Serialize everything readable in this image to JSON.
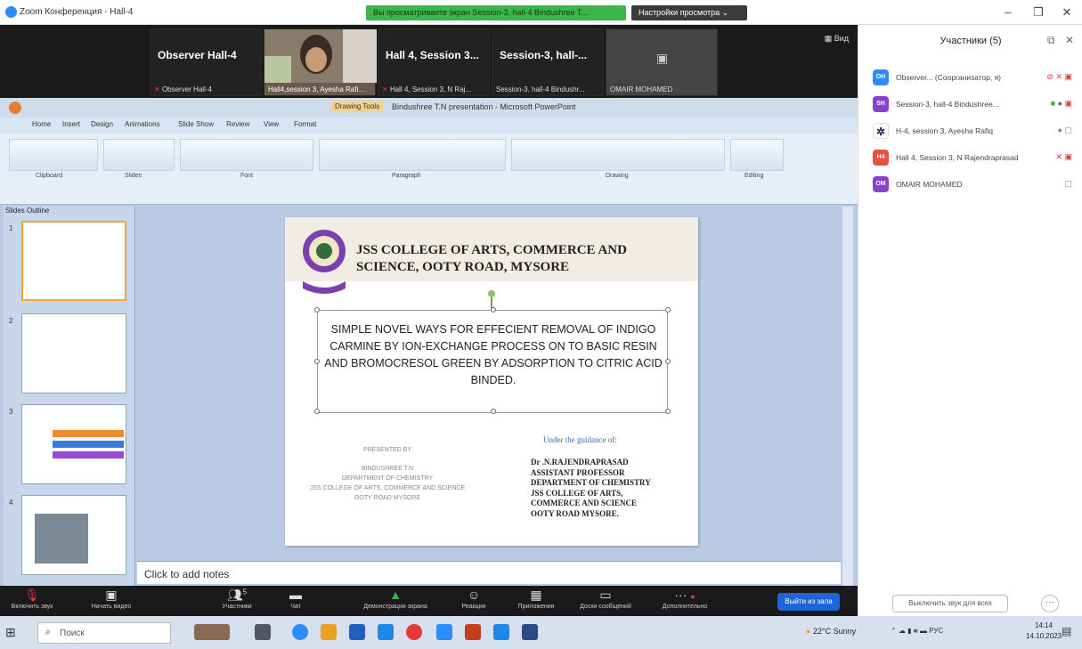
{
  "window": {
    "app_title": "Zoom Конференция - Hall-4",
    "share_banner": "Вы просматриваете экран Session-3, hall-4 Bindushree T...",
    "share_settings": "Настройки просмотра",
    "minimize": "–",
    "maximize": "❐",
    "close": "✕"
  },
  "gallery": {
    "view_label": "Вид",
    "tiles": [
      {
        "name": "Observer Hall-4",
        "footer": "Observer Hall-4"
      },
      {
        "name": "",
        "footer": "Hall4,session 3, Ayesha Rafi..."
      },
      {
        "name": "Hall 4, Session 3...",
        "footer": "Hall 4, Session 3, N Raj..."
      },
      {
        "name": "Session-3, hall-...",
        "footer": "Session-3, hall-4 Bindushr..."
      },
      {
        "name": "",
        "footer": "OMAIR MOHAMED"
      }
    ]
  },
  "panel": {
    "title": "Участники (5)",
    "participants": [
      {
        "initials": "OH",
        "color": "#2d8cff",
        "name": "Observer... (Соорганизатор, я)"
      },
      {
        "initials": "SH",
        "color": "#8b3fd1",
        "name": "Session-3, hall-4 Bindushree..."
      },
      {
        "initials": "",
        "color": "#ffffff",
        "name": "H-4, session 3, Ayesha Rafiq"
      },
      {
        "initials": "H4",
        "color": "#e5533d",
        "name": "Hall 4, Session 3, N Rajendraprasad"
      },
      {
        "initials": "OM",
        "color": "#8b3fd1",
        "name": "OMAIR MOHAMED"
      }
    ],
    "unmute_all": "Выключить звук для всех",
    "more": "···"
  },
  "ppt": {
    "drawing_tools": "Drawing Tools",
    "title": "Bindushree T.N presentation - Microsoft PowerPoint",
    "tabs": [
      "Home",
      "Insert",
      "Design",
      "Animations",
      "Slide Show",
      "Review",
      "View",
      "Format"
    ],
    "groups": [
      "Clipboard",
      "Slides",
      "Font",
      "Paragraph",
      "Drawing",
      "Editing"
    ],
    "thumb_tabs": "Slides   Outline",
    "thumb_numbers": [
      "1",
      "2",
      "3",
      "4"
    ],
    "notes": "Click to add notes"
  },
  "slide": {
    "college": "JSS COLLEGE OF ARTS, COMMERCE AND SCIENCE, OOTY ROAD, MYSORE",
    "title": "SIMPLE NOVEL WAYS FOR EFFECIENT REMOVAL OF INDIGO CARMINE BY ION-EXCHANGE PROCESS ON TO BASIC RESIN AND BROMOCRESOL GREEN BY ADSORPTION TO CITRIC ACID BINDED.",
    "presented_by": "PRESENTED BY",
    "presenter": "BINDUSHREE T.N",
    "presenter_dept": "DEPARTMENT OF CHEMISTRY",
    "presenter_college": "JSS COLLEGE OF ARTS, COMMERCE AND SCIENCE",
    "presenter_addr": "OOTY ROAD MYSORE",
    "guidance": "Under the guidance of:",
    "guide_lines": [
      "Dr .N.RAJENDRAPRASAD",
      "ASSISTANT PROFESSOR",
      "DEPARTMENT OF CHEMISTRY",
      "JSS COLLEGE OF ARTS,",
      "COMMERCE AND SCIENCE",
      "OOTY ROAD MYSORE."
    ]
  },
  "controls": {
    "mic": "Включить звук",
    "video": "Начать видео",
    "participants": "Участники",
    "participants_count": "5",
    "chat": "Чат",
    "share": "Демонстрация экрана",
    "reactions": "Реакции",
    "apps": "Приложения",
    "whiteboard": "Доски сообщений",
    "more": "Дополнительно",
    "leave": "Выйти из зала"
  },
  "taskbar": {
    "search": "Поиск",
    "weather": "22°C  Sunny",
    "lang": "РУС",
    "time": "14:14",
    "date": "14.10.2023"
  },
  "colors": {
    "accent": "#2d8cff",
    "share_green": "#3cb54a",
    "leave_blue": "#1e66d8",
    "mic_muted": "#e53935"
  }
}
